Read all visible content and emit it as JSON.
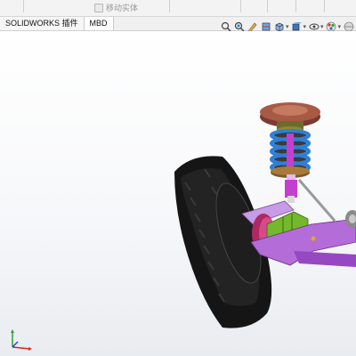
{
  "ribbon": {
    "move_body_label": "移动实体"
  },
  "tabs": [
    {
      "label": "SOLIDWORKS 插件"
    },
    {
      "label": "MBD"
    }
  ],
  "heads_up_toolbar": {
    "icons": [
      "zoom-to-fit-icon",
      "zoom-to-area-icon",
      "sketch-icon",
      "section-view-icon",
      "view-orientation-icon",
      "display-style-icon",
      "hide-show-icon",
      "appearance-icon",
      "scene-icon"
    ]
  },
  "colors": {
    "tire": "#151515",
    "spring": "#2f7fd6",
    "strut": "#c43fd0",
    "mount": "#a85a45",
    "arm": "#b46cd8",
    "boot": "#74b82c"
  }
}
